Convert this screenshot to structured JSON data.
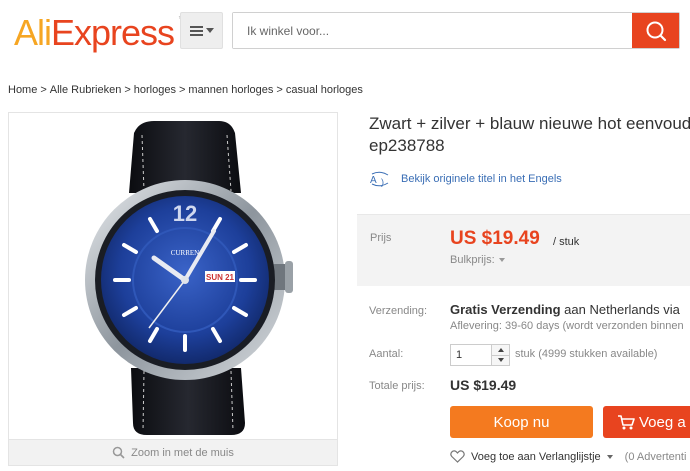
{
  "header": {
    "logo_ali": "Ali",
    "logo_express": "Express",
    "logo_tm": "™",
    "search_placeholder": "Ik winkel voor..."
  },
  "breadcrumb": [
    "Home",
    "Alle Rubrieken",
    "horloges",
    "mannen horloges",
    "casual horloges"
  ],
  "product": {
    "title_line1": "Zwart + zilver + blauw nieuwe hot eenvoud",
    "title_line2": "ep238788",
    "translate_link": "Bekijk originele titel in het Engels",
    "zoom_hint": "Zoom in met de muis",
    "watch_brand": "CURREN",
    "watch_date": "SUN 21"
  },
  "price": {
    "label": "Prijs",
    "value": "US $19.49",
    "unit": "/ stuk",
    "bulk": "Bulkprijs:"
  },
  "shipping": {
    "label": "Verzending:",
    "free": "Gratis Verzending",
    "to": "aan",
    "country": "Netherlands via",
    "delivery": "Aflevering: 39-60 days (wordt verzonden binnen"
  },
  "quantity": {
    "label": "Aantal:",
    "value": "1",
    "available": "stuk (4999 stukken available)"
  },
  "total": {
    "label": "Totale prijs:",
    "value": "US $19.49"
  },
  "actions": {
    "buy_now": "Koop nu",
    "add_cart": "Voeg a",
    "wishlist": "Voeg toe aan Verlanglijstje",
    "wishlist_count": "(0 Advertenti"
  },
  "colors": {
    "brand_orange": "#e8441f",
    "buy_orange": "#f47a1f",
    "logo_yellow": "#f6a623",
    "link_blue": "#3a6eb5"
  }
}
